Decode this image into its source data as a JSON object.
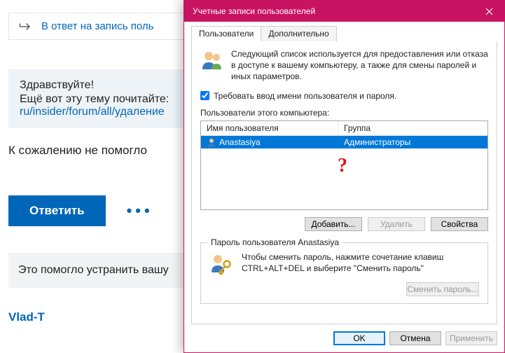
{
  "forum": {
    "reply_to_text": "В ответ на запись поль",
    "quote_line1": "Здравствуйте!",
    "quote_line2": "Ещё вот эту тему почитайте:",
    "quote_link": "ru/insider/forum/all/удаление",
    "no_help": "К сожалению не помогло",
    "reply_btn": "Ответить",
    "helped_text": "Это помогло устранить вашу",
    "username": "Vlad-T"
  },
  "dialog": {
    "title": "Учетные записи пользователей",
    "tabs": {
      "users": "Пользователи",
      "extra": "Дополнительно"
    },
    "intro": "Следующий список используется для предоставления или отказа в доступе к вашему компьютеру, а также для смены паролей и иных параметров.",
    "require_login": "Требовать ввод имени пользователя и пароля.",
    "list_label": "Пользователи этого компьютера:",
    "columns": {
      "user": "Имя пользователя",
      "group": "Группа"
    },
    "rows": [
      {
        "user": "Anastasiya",
        "group": "Администраторы"
      }
    ],
    "question_mark": "?",
    "btn_add": "Добавить...",
    "btn_delete": "Удалить",
    "btn_props": "Свойства",
    "pwd_legend": "Пароль пользователя Anastasiya",
    "pwd_text": "Чтобы сменить пароль, нажмите сочетание клавиш CTRL+ALT+DEL и выберите \"Сменить пароль\"",
    "btn_change_pwd": "Сменить пароль...",
    "btn_ok": "OK",
    "btn_cancel": "Отмена",
    "btn_apply": "Применить"
  }
}
